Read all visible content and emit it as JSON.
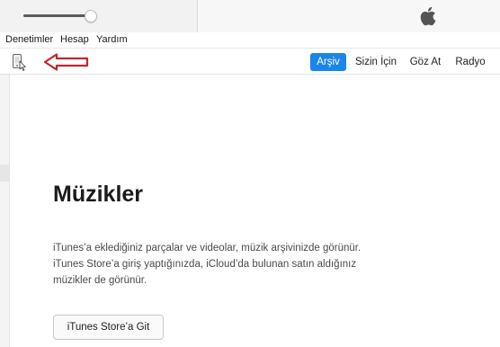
{
  "player": {
    "volume_level": 0.95
  },
  "menu": {
    "items": [
      {
        "label": "Denetimler"
      },
      {
        "label": "Hesap"
      },
      {
        "label": "Yardım"
      }
    ]
  },
  "toolbar": {
    "tabs": [
      {
        "label": "Arşiv",
        "active": true
      },
      {
        "label": "Sizin İçin",
        "active": false
      },
      {
        "label": "Göz At",
        "active": false
      },
      {
        "label": "Radyo",
        "active": false
      }
    ]
  },
  "main": {
    "title": "Müzikler",
    "description_lines": [
      "iTunes’a eklediğiniz parçalar ve videolar, müzik arşivinizde görünür.",
      "iTunes Store’a giriş yaptığınızda, iCloud’da bulunan satın aldığınız",
      "müzikler de görünür."
    ],
    "store_button_label": "iTunes Store’a Git"
  },
  "icons": {
    "apple_logo": "apple-logo-icon",
    "device": "device-icon",
    "annotation_arrow": "red-arrow-icon"
  },
  "colors": {
    "accent": "#1a86e8",
    "annotation_red": "#c0272d",
    "logo_gray": "#555555"
  }
}
